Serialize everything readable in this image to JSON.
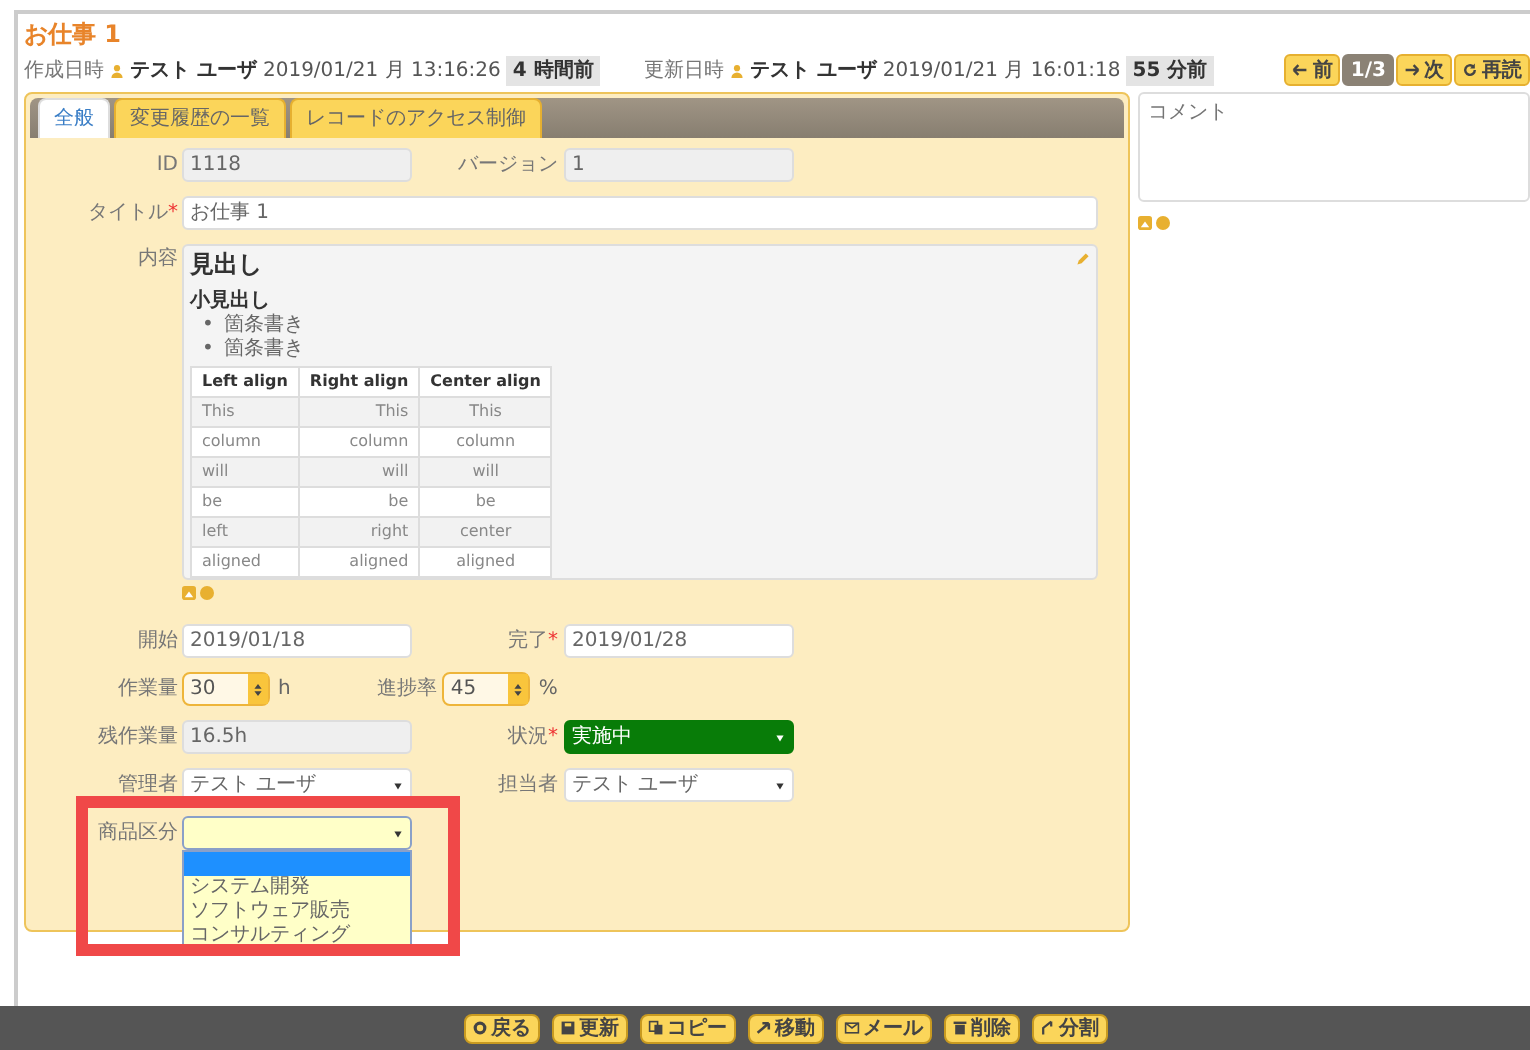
{
  "page_title": "お仕事 1",
  "meta": [
    {
      "label": "作成日時",
      "user": "テスト ユーザ",
      "time": "2019/01/21 月 13:16:26",
      "ago": "4 時間前"
    },
    {
      "label": "更新日時",
      "user": "テスト ユーザ",
      "time": "2019/01/21 月 16:01:18",
      "ago": "55 分前"
    }
  ],
  "nav_buttons": [
    {
      "kind": "prev",
      "label": "前"
    },
    {
      "kind": "page",
      "label": "1/3"
    },
    {
      "kind": "next",
      "label": "次"
    },
    {
      "kind": "reload",
      "label": "再読"
    }
  ],
  "tabs": [
    {
      "label": "全般",
      "selected": true
    },
    {
      "label": "変更履歴の一覧",
      "selected": false
    },
    {
      "label": "レコードのアクセス制御",
      "selected": false
    }
  ],
  "top_rows": [
    [
      {
        "kind": "readonly",
        "label": "ID",
        "value": "1118"
      },
      {
        "kind": "readonly",
        "label": "バージョン",
        "value": "1"
      }
    ],
    [
      {
        "kind": "wide-text",
        "label": "タイトル",
        "required_mark": "*",
        "value": "お仕事 1"
      }
    ]
  ],
  "content": {
    "label": "内容",
    "heading": "見出し",
    "subheading": "小見出し",
    "bullets": [
      {
        "marker": "•",
        "text": "箇条書き"
      },
      {
        "marker": "•",
        "text": "箇条書き"
      }
    ],
    "table": {
      "columns": [
        {
          "label": "Left align",
          "kind": "left"
        },
        {
          "label": "Right align",
          "kind": "right"
        },
        {
          "label": "Center align",
          "kind": "center"
        }
      ],
      "rows": [
        [
          "This",
          "This",
          "This"
        ],
        [
          "column",
          "column",
          "column"
        ],
        [
          "will",
          "will",
          "will"
        ],
        [
          "be",
          "be",
          "be"
        ],
        [
          "left",
          "right",
          "center"
        ],
        [
          "aligned",
          "aligned",
          "aligned"
        ]
      ]
    }
  },
  "bottom_rows": [
    [
      {
        "kind": "text",
        "label": "開始",
        "value": "2019/01/18"
      },
      {
        "kind": "text",
        "label": "完了",
        "required_mark": "*",
        "value": "2019/01/28"
      }
    ],
    [
      {
        "kind": "spinner",
        "label": "作業量",
        "value": "30",
        "unit": "h"
      },
      {
        "kind": "spinner",
        "label": "進捗率",
        "value": "45",
        "unit": "%"
      }
    ],
    [
      {
        "kind": "readonly",
        "label": "残作業量",
        "value": "16.5h"
      },
      {
        "kind": "status-select",
        "label": "状況",
        "required_mark": "*",
        "value": "実施中"
      }
    ],
    [
      {
        "kind": "select",
        "label": "管理者",
        "value": "テスト ユーザ"
      },
      {
        "kind": "select",
        "label": "担当者",
        "value": "テスト ユーザ"
      }
    ],
    [
      {
        "kind": "open-select",
        "label": "商品区分",
        "blank_option_selected": true,
        "options": [
          "システム開発",
          "ソフトウェア販売",
          "コンサルティング"
        ]
      }
    ]
  ],
  "comment": {
    "placeholder": "コメント"
  },
  "highlight_frame": true,
  "footer_buttons": [
    {
      "kind": "back",
      "label": "戻る"
    },
    {
      "kind": "update",
      "label": "更新"
    },
    {
      "kind": "copy",
      "label": "コピー"
    },
    {
      "kind": "move",
      "label": "移動"
    },
    {
      "kind": "mail",
      "label": "メール"
    },
    {
      "kind": "delete",
      "label": "削除"
    },
    {
      "kind": "split",
      "label": "分割"
    }
  ]
}
